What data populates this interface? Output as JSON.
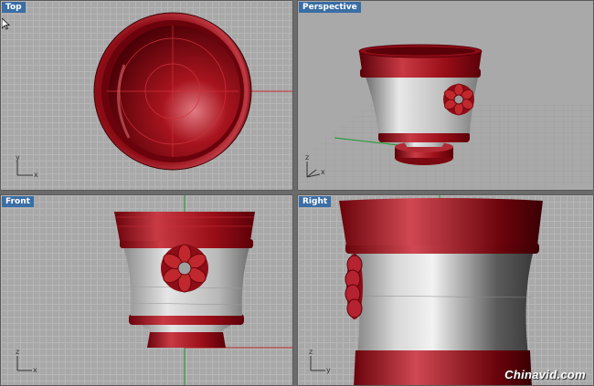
{
  "viewports": {
    "top": {
      "title": "Top"
    },
    "perspective": {
      "title": "Perspective"
    },
    "front": {
      "title": "Front"
    },
    "right": {
      "title": "Right"
    }
  },
  "axes": {
    "x": "x",
    "y": "y",
    "z": "z"
  },
  "watermark": "Chinavid.com",
  "colors": {
    "model": "#9a0e18",
    "model_highlight": "#d94a55",
    "body_silver": "#c8c8c8",
    "grid_bg": "#a8a8a8",
    "title_bg": "#3a6ea5",
    "axis_x": "#c0282e",
    "axis_y": "#1a9a2a"
  },
  "icons": [
    "mouse-cursor-icon",
    "axis-gizmo-icon"
  ]
}
